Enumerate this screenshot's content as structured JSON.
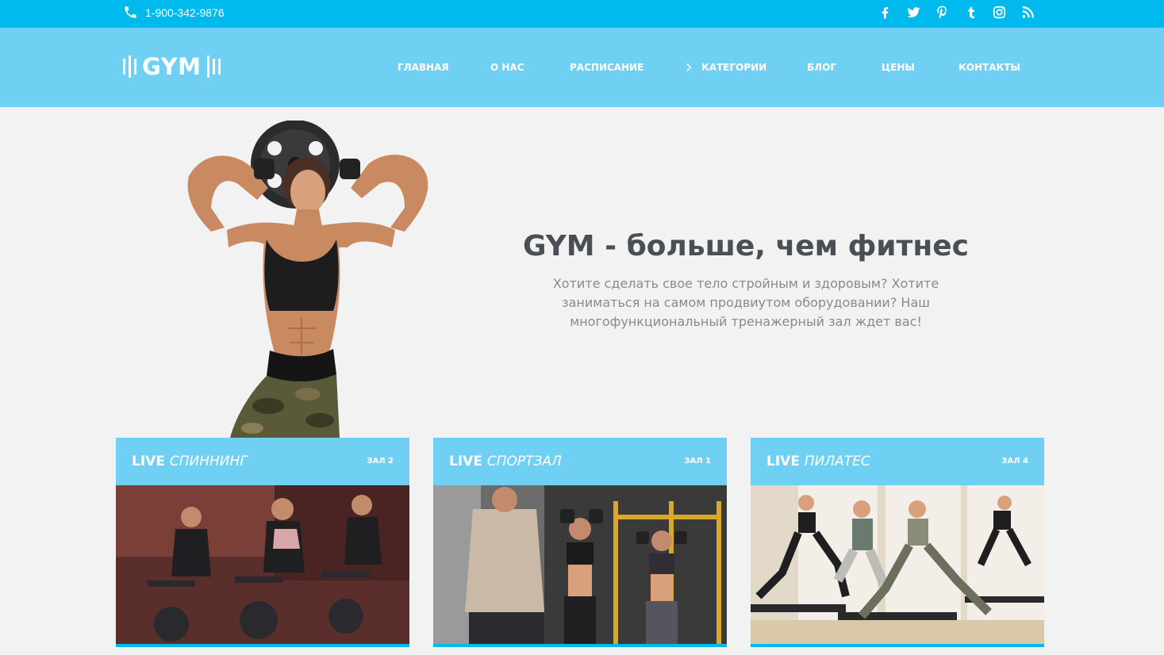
{
  "topbar": {
    "phone": "1-900-342-9876",
    "socials": [
      "facebook-icon",
      "twitter-icon",
      "pinterest-icon",
      "tumblr-icon",
      "instagram-icon",
      "rss-icon"
    ]
  },
  "header": {
    "logo": "GYM",
    "nav": [
      {
        "label": "ГЛАВНАЯ"
      },
      {
        "label": "О НАС"
      },
      {
        "label": "РАСПИСАНИЕ"
      },
      {
        "label": "КАТЕГОРИИ",
        "has_submenu": true
      },
      {
        "label": "БЛОГ"
      },
      {
        "label": "ЦЕНЫ"
      },
      {
        "label": "КОНТАКТЫ"
      }
    ]
  },
  "hero": {
    "title": "GYM - больше, чем фитнес",
    "text": "Хотите сделать свое тело стройным и здоровым? Хотите заниматься на самом продвиутом оборудовании? Наш многофункциональный тренажерный зал ждет вас!"
  },
  "cards": [
    {
      "live": "LIVE",
      "name": "СПИННИНГ",
      "hall": "ЗАЛ 2"
    },
    {
      "live": "LIVE",
      "name": "СПОРТЗАЛ",
      "hall": "ЗАЛ 1"
    },
    {
      "live": "LIVE",
      "name": "ПИЛАТЕС",
      "hall": "ЗАЛ 4"
    }
  ],
  "colors": {
    "topbar": "#00b9ed",
    "header": "#6fd0f4",
    "background": "#f2f2f2",
    "title": "#4a4f55",
    "body_text": "#8a8a8a"
  }
}
